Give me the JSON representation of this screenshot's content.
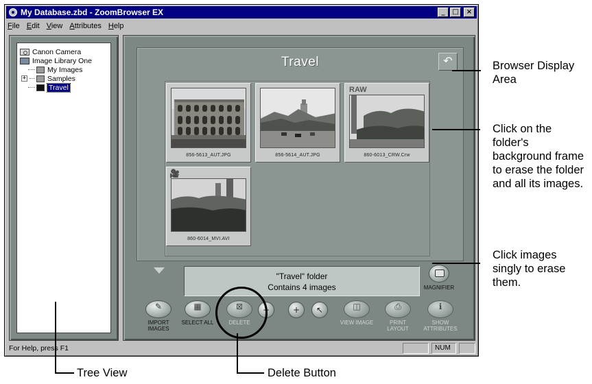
{
  "window": {
    "title": "My Database.zbd - ZoomBrowser EX",
    "controls": [
      "_",
      "□",
      "×"
    ]
  },
  "menu": [
    "File",
    "Edit",
    "View",
    "Attributes",
    "Help"
  ],
  "tree": {
    "items": [
      {
        "label": "Canon Camera",
        "icon": "camera-icon"
      },
      {
        "label": "Image Library One",
        "icon": "library-icon"
      },
      {
        "label": "My Images",
        "icon": "folder-icon"
      },
      {
        "label": "Samples",
        "icon": "folder-icon",
        "expander": "+"
      },
      {
        "label": "Travel",
        "icon": "folder-open-icon",
        "selected": true
      }
    ]
  },
  "browser": {
    "folder_title": "Travel",
    "return_icon": "↶",
    "thumbnails": [
      {
        "caption": "856-5613_AUT.JPG",
        "badge": ""
      },
      {
        "caption": "856-5614_AUT.JPG",
        "badge": ""
      },
      {
        "caption": "860-6013_CRW.Crw",
        "badge": "RAW"
      },
      {
        "caption": "860-6014_MVI.AVI",
        "badge": "movie-camera-icon"
      }
    ],
    "info": {
      "line1": "\"Travel\" folder",
      "line2": "Contains 4 images"
    },
    "magnifier_label": "MAGNIFIER",
    "toolbar": [
      {
        "label": "IMPORT IMAGES",
        "glyph": "✎"
      },
      {
        "label": "SELECT ALL",
        "glyph": "▦"
      },
      {
        "label": "DELETE",
        "glyph": "⊠"
      },
      {
        "label": "VIEW IMAGE",
        "glyph": "◫"
      },
      {
        "label": "PRINT LAYOUT",
        "glyph": "⎙"
      },
      {
        "label": "SHOW ATTRIBUTES",
        "glyph": "ℹ"
      }
    ],
    "zoom": {
      "out": "−",
      "in": "+",
      "pointer": "↖"
    }
  },
  "statusbar": {
    "help": "For Help, press F1",
    "num": "NUM"
  },
  "annotations": {
    "browser_display_area": "Browser Display Area",
    "erase_folder": "Click on the folder's background frame to erase the folder and all its images.",
    "erase_images": "Click images singly to erase them.",
    "tree_view": "Tree View",
    "delete_button": "Delete Button"
  }
}
